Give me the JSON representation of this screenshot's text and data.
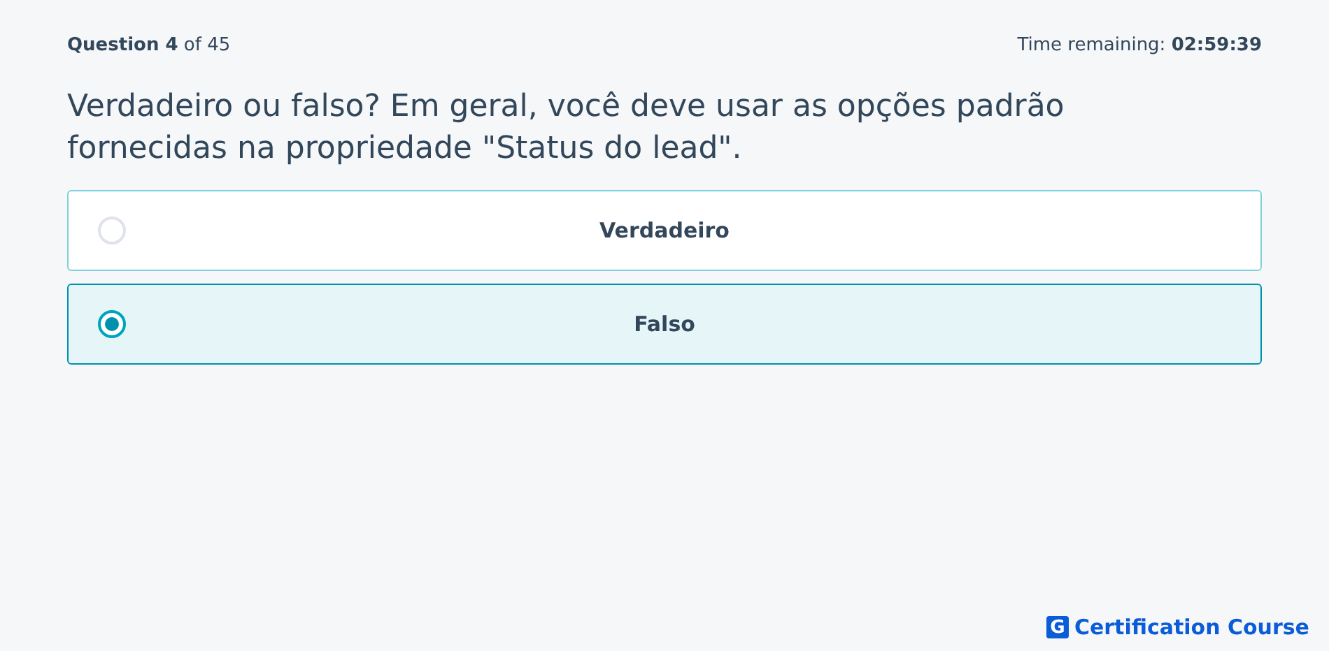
{
  "header": {
    "progress": "**Question 4** of 45",
    "timer": "Time remaining: **02:59:39**"
  },
  "question": "Verdadeiro ou falso? Em geral, você deve usar as opções padrão fornecidas na propriedade \"Status do lead\".",
  "options": [
    {
      "label": "Verdadeiro",
      "selected": false
    },
    {
      "label": "Falso",
      "selected": true
    }
  ],
  "footer": {
    "logo_letter": "G",
    "brand": "Certification Course"
  }
}
